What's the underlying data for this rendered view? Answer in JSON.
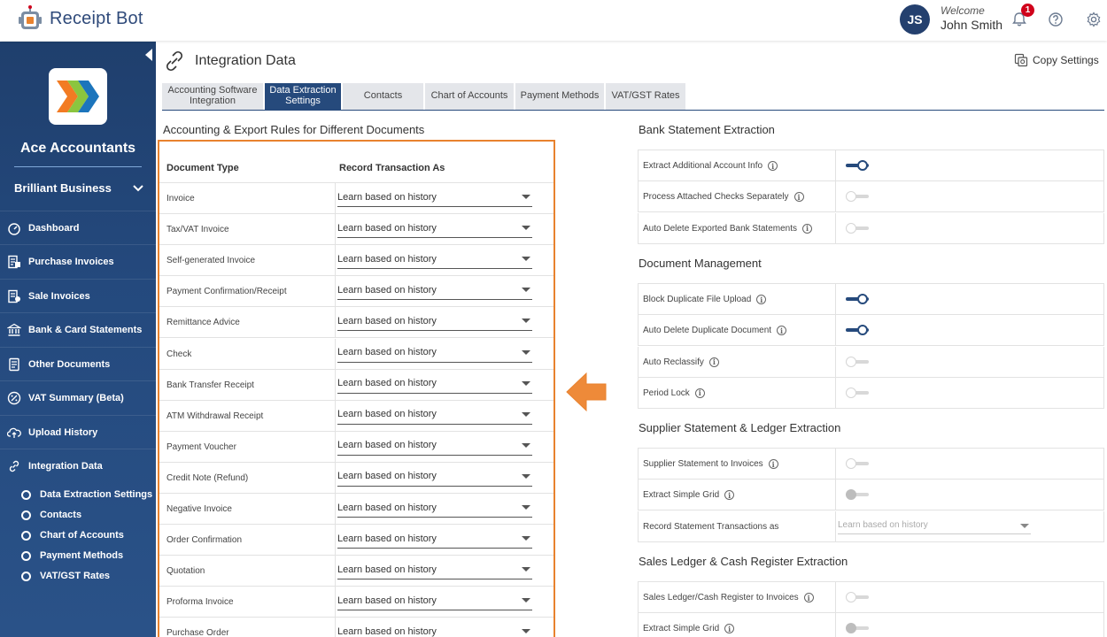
{
  "app": {
    "name": "Receipt Bot"
  },
  "user": {
    "initials": "JS",
    "welcome": "Welcome",
    "name": "John Smith",
    "notifications": "1"
  },
  "sidebar": {
    "org_name": "Ace Accountants",
    "business": "Brilliant Business",
    "items": [
      {
        "label": "Dashboard",
        "icon": "dashboard-icon"
      },
      {
        "label": "Purchase Invoices",
        "icon": "purchase-invoice-icon"
      },
      {
        "label": "Sale Invoices",
        "icon": "sale-invoice-icon"
      },
      {
        "label": "Bank & Card Statements",
        "icon": "bank-icon"
      },
      {
        "label": "Other Documents",
        "icon": "document-icon"
      },
      {
        "label": "VAT Summary (Beta)",
        "icon": "percent-icon"
      },
      {
        "label": "Upload History",
        "icon": "upload-icon"
      },
      {
        "label": "Integration Data",
        "icon": "link-icon"
      }
    ],
    "sub_items": [
      "Data Extraction Settings",
      "Contacts",
      "Chart of Accounts",
      "Payment Methods",
      "VAT/GST Rates"
    ]
  },
  "page": {
    "title": "Integration Data",
    "copy_settings": "Copy Settings"
  },
  "tabs": [
    {
      "label": "Accounting Software Integration",
      "active": false
    },
    {
      "label": "Data Extraction Settings",
      "active": true
    },
    {
      "label": "Contacts",
      "active": false
    },
    {
      "label": "Chart of Accounts",
      "active": false
    },
    {
      "label": "Payment Methods",
      "active": false
    },
    {
      "label": "VAT/GST Rates",
      "active": false
    }
  ],
  "rules": {
    "title": "Accounting & Export Rules for Different Documents",
    "col_doc": "Document Type",
    "col_record": "Record Transaction As",
    "rows": [
      {
        "doc": "Invoice",
        "value": "Learn based on history"
      },
      {
        "doc": "Tax/VAT Invoice",
        "value": "Learn based on history"
      },
      {
        "doc": "Self-generated Invoice",
        "value": "Learn based on history"
      },
      {
        "doc": "Payment Confirmation/Receipt",
        "value": "Learn based on history"
      },
      {
        "doc": "Remittance Advice",
        "value": "Learn based on history"
      },
      {
        "doc": "Check",
        "value": "Learn based on history"
      },
      {
        "doc": "Bank Transfer Receipt",
        "value": "Learn based on history"
      },
      {
        "doc": "ATM Withdrawal Receipt",
        "value": "Learn based on history"
      },
      {
        "doc": "Payment Voucher",
        "value": "Learn based on history"
      },
      {
        "doc": "Credit Note (Refund)",
        "value": "Learn based on history"
      },
      {
        "doc": "Negative Invoice",
        "value": "Learn based on history"
      },
      {
        "doc": "Order Confirmation",
        "value": "Learn based on history"
      },
      {
        "doc": "Quotation",
        "value": "Learn based on history"
      },
      {
        "doc": "Proforma Invoice",
        "value": "Learn based on history"
      },
      {
        "doc": "Purchase Order",
        "value": "Learn based on history"
      }
    ]
  },
  "bank": {
    "title": "Bank Statement Extraction",
    "rows": [
      {
        "label": "Extract Additional Account Info",
        "on": true
      },
      {
        "label": "Process Attached Checks Separately",
        "on": false
      },
      {
        "label": "Auto Delete Exported Bank Statements",
        "on": false
      }
    ]
  },
  "docmgmt": {
    "title": "Document Management",
    "rows": [
      {
        "label": "Block Duplicate File Upload",
        "on": true
      },
      {
        "label": "Auto Delete Duplicate Document",
        "on": true
      },
      {
        "label": "Auto Reclassify",
        "on": false
      },
      {
        "label": "Period Lock",
        "on": false
      }
    ]
  },
  "supplier": {
    "title": "Supplier Statement & Ledger Extraction",
    "rows": [
      {
        "label": "Supplier Statement to Invoices",
        "on": false
      },
      {
        "label": "Extract Simple Grid",
        "on": false
      },
      {
        "label": "Record Statement Transactions as",
        "select": "Learn based on history"
      }
    ]
  },
  "sales": {
    "title": "Sales Ledger & Cash Register Extraction",
    "rows": [
      {
        "label": "Sales Ledger/Cash Register to Invoices",
        "on": false
      },
      {
        "label": "Extract Simple Grid",
        "on": false
      }
    ]
  },
  "colors": {
    "primary": "#264a7c",
    "highlight": "#e8822e",
    "badge": "#d0021b"
  }
}
